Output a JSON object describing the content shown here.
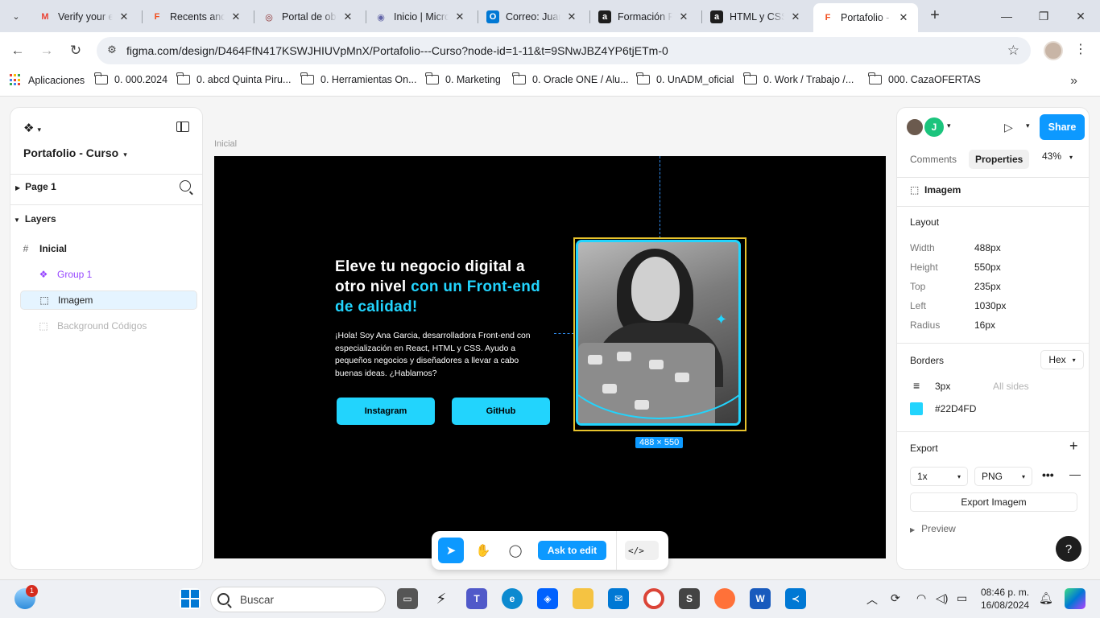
{
  "browser": {
    "tabs": [
      {
        "title": "Verify your e",
        "icon": "gmail-icon",
        "color": "#ea4335"
      },
      {
        "title": "Recents and",
        "icon": "figma-icon",
        "color": "#f24e1e"
      },
      {
        "title": "Portal de obl",
        "icon": "portal-icon",
        "color": "#8a2b2b"
      },
      {
        "title": "Inicio | Micro",
        "icon": "microsoft365-icon",
        "color": "#6264a7"
      },
      {
        "title": "Correo: Juan",
        "icon": "outlook-icon",
        "color": "#0078d4"
      },
      {
        "title": "Formación P",
        "icon": "alura-icon",
        "color": "#1e1e1e"
      },
      {
        "title": "HTML y CSS:",
        "icon": "alura-icon",
        "color": "#1e1e1e"
      },
      {
        "title": "Portafolio - C",
        "icon": "figma-icon",
        "color": "#f24e1e"
      }
    ],
    "url": "figma.com/design/D464FfN417KSWJHIUVpMnX/Portafolio---Curso?node-id=1-11&t=9SNwJBZ4YP6tjETm-0",
    "bookmarks": [
      "Aplicaciones",
      "0. 000.2024",
      "0. abcd Quinta Piru...",
      "0. Herramientas On...",
      "0. Marketing",
      "0. Oracle ONE / Alu...",
      "0. UnADM_oficial",
      "0. Work / Trabajo /...",
      "000. CazaOFERTAS"
    ]
  },
  "figma": {
    "file_name": "Portafolio - Curso",
    "page": "Page 1",
    "layers_title": "Layers",
    "layers": [
      {
        "name": "Inicial",
        "icon": "#"
      },
      {
        "name": "Group 1",
        "icon": "❖"
      },
      {
        "name": "Imagem",
        "icon": "⬚"
      },
      {
        "name": "Background Códigos",
        "icon": "⬚"
      }
    ],
    "frame_label": "Inicial",
    "hero": {
      "title_white": "Eleve tu negocio digital a otro nivel ",
      "title_accent": "con un Front-end de calidad!",
      "text": "¡Hola! Soy Ana Garcia, desarrolladora Front-end con especialización en React, HTML y CSS. Ayudo a pequeños negocios y diseñadores a llevar a cabo buenas ideas. ¿Hablamos?",
      "btn_instagram": "Instagram",
      "btn_github": "GitHub"
    },
    "selection_dims": "488 × 550",
    "toolbar": {
      "ask_label": "Ask to edit",
      "code_label": "</>"
    },
    "right": {
      "user_initial": "J",
      "share": "Share",
      "tab_comments": "Comments",
      "tab_properties": "Properties",
      "zoom": "43%",
      "selected_name": "Imagem",
      "layout_title": "Layout",
      "props": [
        {
          "k": "Width",
          "v": "488px"
        },
        {
          "k": "Height",
          "v": "550px"
        },
        {
          "k": "Top",
          "v": "235px"
        },
        {
          "k": "Left",
          "v": "1030px"
        },
        {
          "k": "Radius",
          "v": "16px"
        }
      ],
      "borders_title": "Borders",
      "color_mode": "Hex",
      "border_width": "3px",
      "border_sides": "All sides",
      "border_color": "#22D4FD",
      "export_title": "Export",
      "export_scale": "1x",
      "export_format": "PNG",
      "export_button": "Export Imagem",
      "preview": "Preview",
      "help": "?"
    }
  },
  "taskbar": {
    "search_placeholder": "Buscar",
    "notification_count": "1",
    "time": "08:46 p. m.",
    "date": "16/08/2024"
  }
}
